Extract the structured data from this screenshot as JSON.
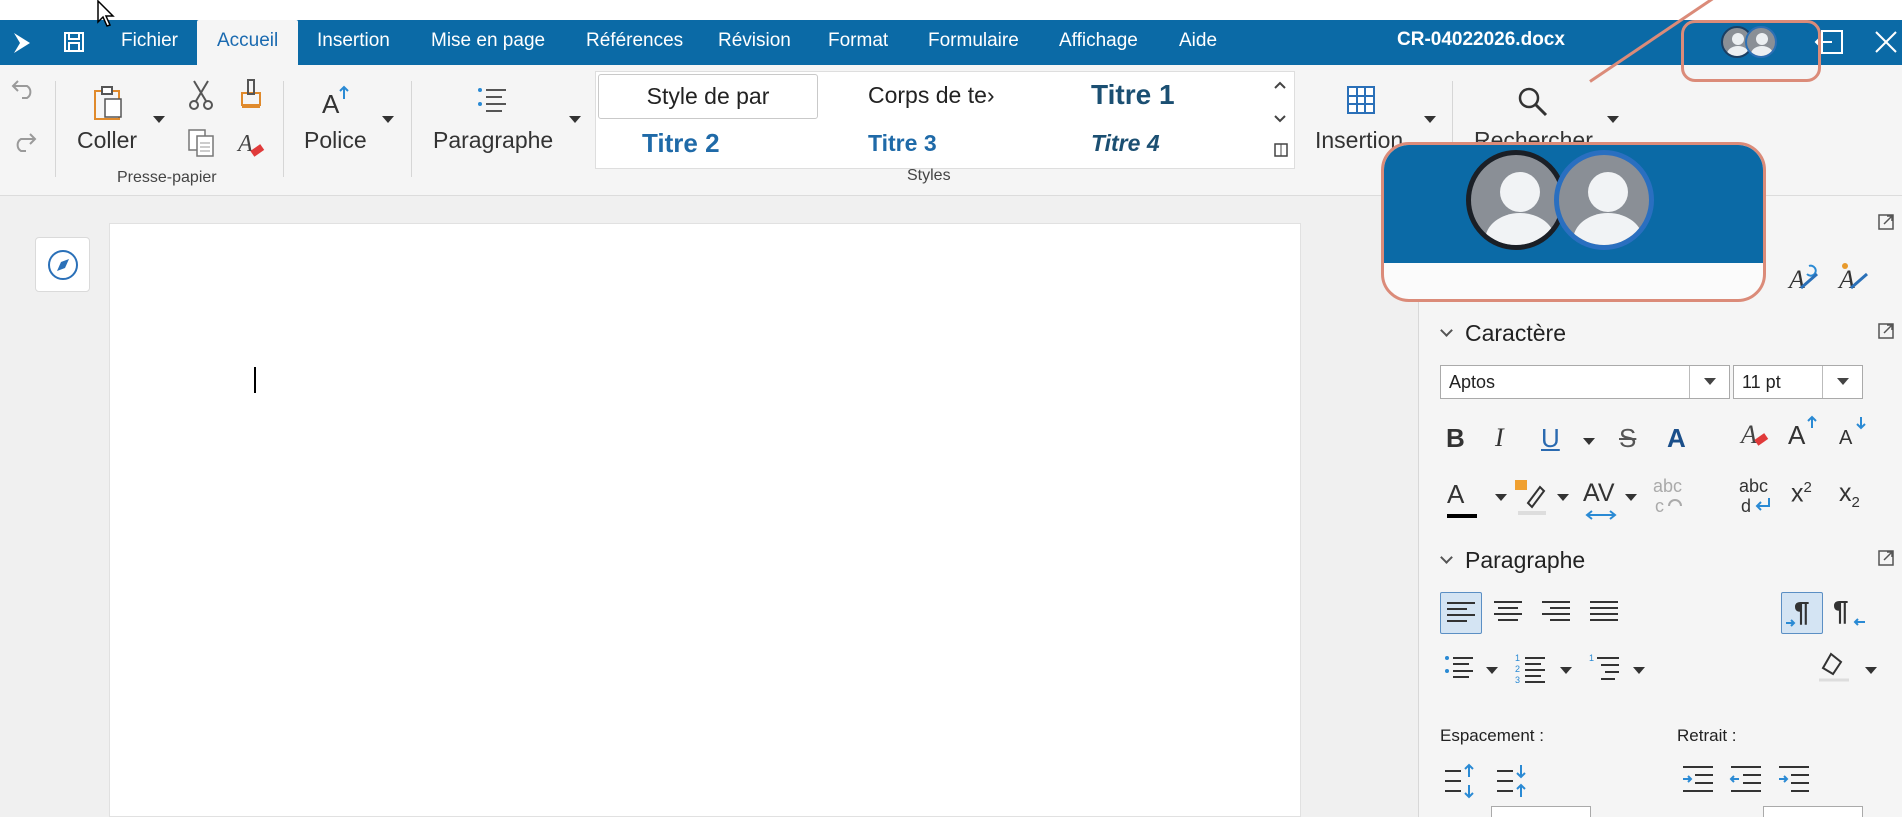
{
  "menubar": {
    "items": [
      {
        "label": "Fichier"
      },
      {
        "label": "Accueil",
        "active": true
      },
      {
        "label": "Insertion"
      },
      {
        "label": "Mise en page"
      },
      {
        "label": "Références"
      },
      {
        "label": "Révision"
      },
      {
        "label": "Format"
      },
      {
        "label": "Formulaire"
      },
      {
        "label": "Affichage"
      },
      {
        "label": "Aide"
      }
    ],
    "document_title": "CR-04022026.docx",
    "accent_color": "#0b6aa6"
  },
  "ribbon": {
    "clipboard": {
      "paste_label": "Coller",
      "group_label": "Presse-papier"
    },
    "font": {
      "label": "Police"
    },
    "paragraph": {
      "label": "Paragraphe"
    },
    "styles": {
      "group_label": "Styles",
      "items": [
        {
          "label": "Style de par",
          "selected": true
        },
        {
          "label": "Corps de te›"
        },
        {
          "label": "Titre 1"
        },
        {
          "label": "Titre 2"
        },
        {
          "label": "Titre 3"
        },
        {
          "label": "Titre 4"
        }
      ]
    },
    "insert": {
      "label": "Insertion"
    },
    "search": {
      "label": "Rechercher"
    }
  },
  "sidebar": {
    "character": {
      "title": "Caractère",
      "font_name": "Aptos",
      "font_size": "11 pt",
      "bold": "B",
      "italic": "I",
      "underline": "U",
      "strike": "S",
      "outline": "A",
      "font_color": "A",
      "spacing": "AV",
      "superscript_base": "x",
      "superscript_mark": "2",
      "subscript_base": "x",
      "subscript_mark": "2"
    },
    "paragraph": {
      "title": "Paragraphe",
      "spacing_label": "Espacement :",
      "indent_label": "Retrait :"
    }
  },
  "callout": {
    "border_color": "#db8b79"
  }
}
